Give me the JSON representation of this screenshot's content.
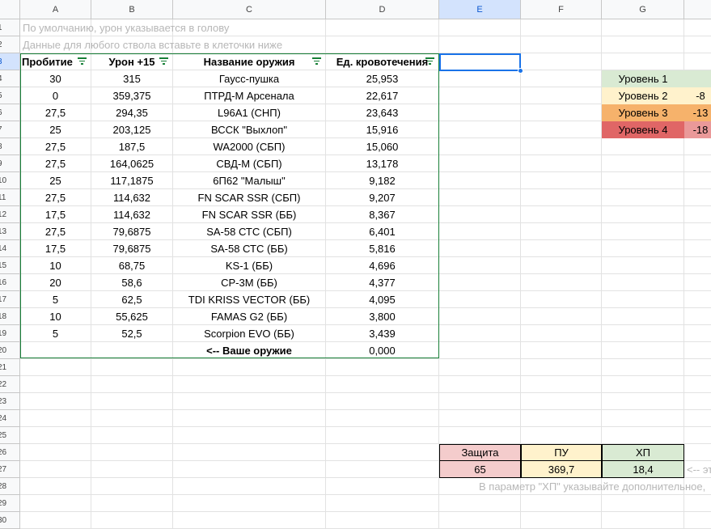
{
  "columns": [
    "A",
    "B",
    "C",
    "D",
    "E",
    "F",
    "G",
    ""
  ],
  "rows": [
    "1",
    "2",
    "3",
    "4",
    "5",
    "6",
    "7",
    "8",
    "9",
    "10",
    "11",
    "12",
    "13",
    "14",
    "15",
    "16",
    "17",
    "18",
    "19",
    "20",
    "21",
    "22",
    "23",
    "24",
    "25",
    "26",
    "27",
    "28",
    "29",
    "30"
  ],
  "notes": {
    "row1": "По умолчанию, урон указывается в голову",
    "row2": "Данные для любого ствола вставьте  в клеточки ниже",
    "row27_right": "<-- эт",
    "row28": "В параметр \"ХП\" указывайте дополнительное,"
  },
  "table": {
    "headers": [
      "Пробитие",
      "Урон +15",
      "Название оружия",
      "Ед. кровотечения"
    ],
    "rows": [
      [
        "30",
        "315",
        "Гаусс-пушка",
        "25,953"
      ],
      [
        "0",
        "359,375",
        "ПТРД-М Арсенала",
        "22,617"
      ],
      [
        "27,5",
        "294,35",
        "L96A1 (СНП)",
        "23,643"
      ],
      [
        "25",
        "203,125",
        "ВССК \"Выхлоп\"",
        "15,916"
      ],
      [
        "27,5",
        "187,5",
        "WA2000 (СБП)",
        "15,060"
      ],
      [
        "27,5",
        "164,0625",
        "СВД-М (СБП)",
        "13,178"
      ],
      [
        "25",
        "117,1875",
        "6П62 \"Малыш\"",
        "9,182"
      ],
      [
        "27,5",
        "114,632",
        "FN SCAR SSR (СБП)",
        "9,207"
      ],
      [
        "17,5",
        "114,632",
        "FN SCAR SSR (ББ)",
        "8,367"
      ],
      [
        "27,5",
        "79,6875",
        "SA-58 СТС (СБП)",
        "6,401"
      ],
      [
        "17,5",
        "79,6875",
        "SA-58 СТС (ББ)",
        "5,816"
      ],
      [
        "10",
        "68,75",
        "KS-1 (ББ)",
        "4,696"
      ],
      [
        "20",
        "58,6",
        "СР-3М (ББ)",
        "4,377"
      ],
      [
        "5",
        "62,5",
        "TDI KRISS VECTOR (ББ)",
        "4,095"
      ],
      [
        "10",
        "55,625",
        "FAMAS G2 (ББ)",
        "3,800"
      ],
      [
        "5",
        "52,5",
        "Scorpion EVO (ББ)",
        "3,439"
      ],
      [
        "",
        "",
        "<-- Ваше оружие",
        "0,000"
      ]
    ]
  },
  "levels": [
    {
      "label": "Уровень 1",
      "value": "",
      "color": "#d9ead3",
      "valcolor": "#d9ead3"
    },
    {
      "label": "Уровень 2",
      "value": "-8",
      "color": "#fff2cc",
      "valcolor": "#fff2cc"
    },
    {
      "label": "Уровень 3",
      "value": "-13",
      "color": "#f6b26b",
      "valcolor": "#f6b26b"
    },
    {
      "label": "Уровень 4",
      "value": "-18",
      "color": "#e06666",
      "valcolor": "#ea9999"
    }
  ],
  "stats": {
    "headers": [
      "Защита",
      "ПУ",
      "ХП"
    ],
    "values": [
      "65",
      "369,7",
      "18,4"
    ],
    "colors": [
      "#f4cccc",
      "#fff2cc",
      "#d9ead3"
    ]
  },
  "colors": {
    "table_border": "#188038",
    "selection": "#1a73e8",
    "header_selected": "#d3e3fd"
  }
}
